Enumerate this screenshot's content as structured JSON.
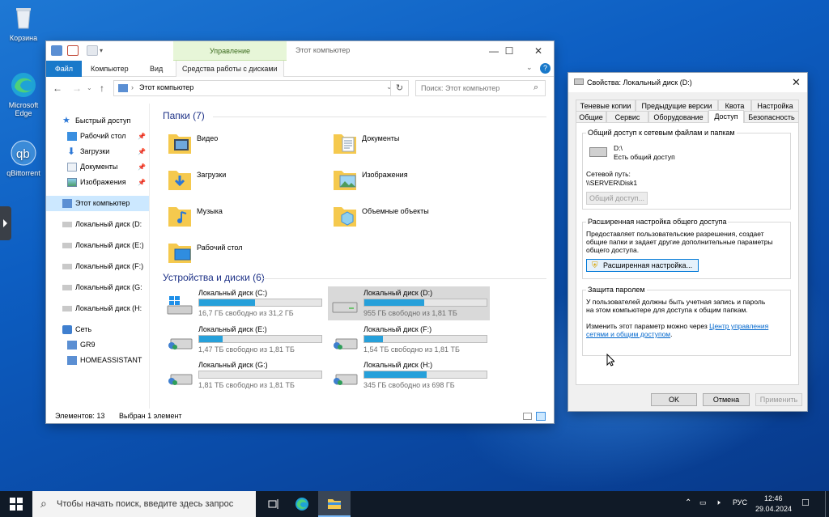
{
  "desktop": {
    "icons": [
      {
        "label": "Корзина"
      },
      {
        "label": "Microsoft Edge"
      },
      {
        "label": "qBittorrent"
      }
    ]
  },
  "explorer": {
    "title": "Этот компьютер",
    "context_tab": "Управление",
    "ribbon_tabs": [
      "Файл",
      "Компьютер",
      "Вид",
      "Средства работы с дисками"
    ],
    "address": "Этот компьютер",
    "search_placeholder": "Поиск: Этот компьютер",
    "nav": {
      "quick_access": "Быстрый доступ",
      "quick_items": [
        "Рабочий стол",
        "Загрузки",
        "Документы",
        "Изображения"
      ],
      "this_pc": "Этот компьютер",
      "drives": [
        "Локальный диск (D:",
        "Локальный диск (E:)",
        "Локальный диск (F:)",
        "Локальный диск (G:",
        "Локальный диск (H:"
      ],
      "network": "Сеть",
      "network_items": [
        "GR9",
        "HOMEASSISTANT"
      ]
    },
    "folders_header": "Папки (7)",
    "folders": [
      "Видео",
      "Документы",
      "Загрузки",
      "Изображения",
      "Музыка",
      "Объемные объекты",
      "Рабочий стол"
    ],
    "drives_header": "Устройства и диски (6)",
    "drives": [
      {
        "name": "Локальный диск (C:)",
        "free": "16,7 ГБ свободно из 31,2 ГБ",
        "used_fraction": 0.46
      },
      {
        "name": "Локальный диск (D:)",
        "free": "955 ГБ свободно из 1,81 ТБ",
        "used_fraction": 0.49
      },
      {
        "name": "Локальный диск (E:)",
        "free": "1,47 ТБ свободно из 1,81 ТБ",
        "used_fraction": 0.19
      },
      {
        "name": "Локальный диск (F:)",
        "free": "1,54 ТБ свободно из 1,81 ТБ",
        "used_fraction": 0.15
      },
      {
        "name": "Локальный диск (G:)",
        "free": "1,81 ТБ свободно из 1,81 ТБ",
        "used_fraction": 0.0
      },
      {
        "name": "Локальный диск (H:)",
        "free": "345 ГБ свободно из 698 ГБ",
        "used_fraction": 0.51
      }
    ],
    "status_count": "Элементов: 13",
    "status_selected": "Выбран 1 элемент"
  },
  "props": {
    "title": "Свойства: Локальный диск (D:)",
    "tabs_row1": [
      "Теневые копии",
      "Предыдущие версии",
      "Квота",
      "Настройка"
    ],
    "tabs_row2": [
      "Общие",
      "Сервис",
      "Оборудование",
      "Доступ",
      "Безопасность"
    ],
    "share": {
      "group": "Общий доступ к сетевым файлам и папкам",
      "drive": "D:\\",
      "state": "Есть общий доступ",
      "path_label": "Сетевой путь:",
      "path": "\\\\SERVER\\Disk1",
      "button": "Общий доступ..."
    },
    "advanced": {
      "group": "Расширенная настройка общего доступа",
      "text1": "Предоставляет пользовательские разрешения, создает",
      "text2": "общие папки и задает другие дополнительные параметры",
      "text3": "общего доступа.",
      "button": "Расширенная настройка..."
    },
    "password": {
      "group": "Защита паролем",
      "text1": "У пользователей должны быть учетная запись и пароль",
      "text2": "на этом компьютере для доступа к общим папкам.",
      "text3a": "Изменить этот параметр можно через",
      "link1": "Центр управления",
      "link2": "сетями и общим доступом",
      "text3b": "."
    },
    "buttons": {
      "ok": "OK",
      "cancel": "Отмена",
      "apply": "Применить"
    }
  },
  "taskbar": {
    "search_placeholder": "Чтобы начать поиск, введите здесь запрос",
    "lang": "РУС",
    "time": "12:46",
    "date": "29.04.2024"
  }
}
